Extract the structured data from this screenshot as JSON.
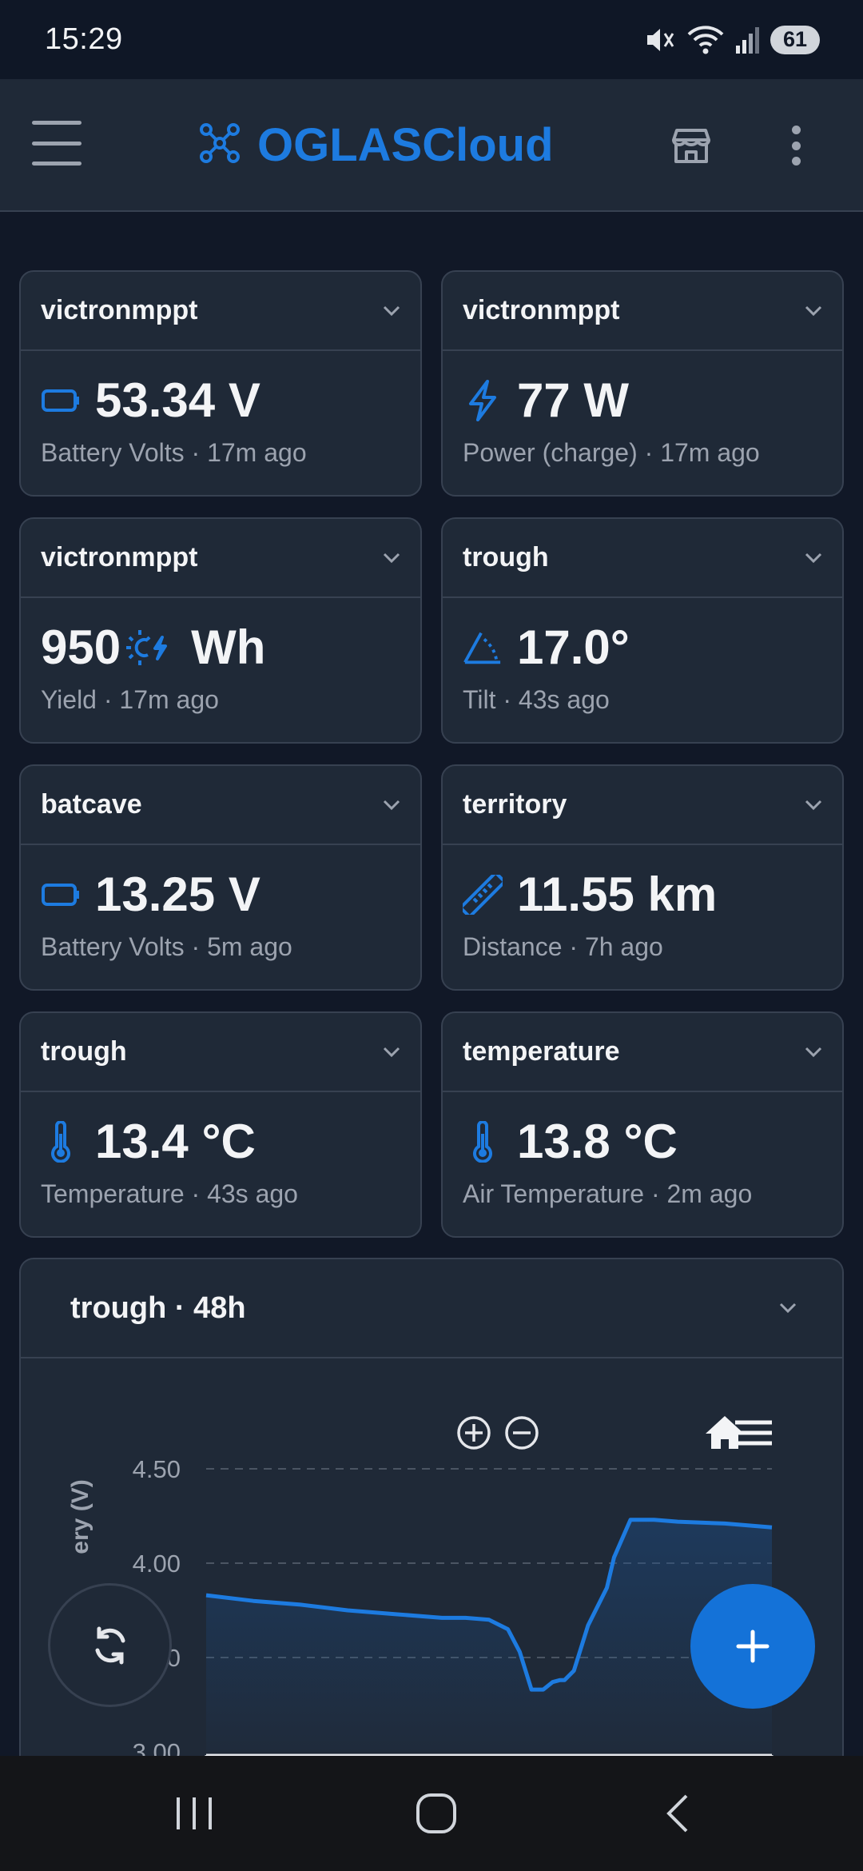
{
  "status_bar": {
    "time": "15:29",
    "battery": "61",
    "icons": [
      "mute-icon",
      "wifi-icon",
      "signal-icon",
      "battery-icon"
    ]
  },
  "header": {
    "title": "OGLASCloud",
    "icons": [
      "menu-icon",
      "brand-logo-icon",
      "store-icon",
      "more-vert-icon"
    ]
  },
  "cards": [
    {
      "device": "victronmppt",
      "value": "53.34 V",
      "sub": "Battery Volts · 17m ago",
      "icon": "battery-icon"
    },
    {
      "device": "victronmppt",
      "value": "77 W",
      "sub": "Power (charge) · 17m ago",
      "icon": "bolt-icon"
    },
    {
      "device": "victronmppt",
      "value": "950",
      "unit": "Wh",
      "sub": "Yield · 17m ago",
      "icon": "sun-bolt-icon"
    },
    {
      "device": "trough",
      "value": "17.0°",
      "sub": "Tilt · 43s ago",
      "icon": "angle-icon"
    },
    {
      "device": "batcave",
      "value": "13.25 V",
      "sub": "Battery Volts · 5m ago",
      "icon": "battery-icon"
    },
    {
      "device": "territory",
      "value": "11.55 km",
      "sub": "Distance · 7h ago",
      "icon": "ruler-icon"
    },
    {
      "device": "trough",
      "value": "13.4 °C",
      "sub": "Temperature · 43s ago",
      "icon": "thermometer-icon"
    },
    {
      "device": "temperature",
      "value": "13.8 °C",
      "sub": "Air Temperature · 2m ago",
      "icon": "thermometer-icon"
    }
  ],
  "chart_card": {
    "title": "trough · 48h"
  },
  "chart_data": {
    "type": "area",
    "ylabel_visible": "ery (V)",
    "y_ticks": [
      "4.50",
      "4.00",
      "0",
      "3.00"
    ],
    "ylim": [
      3.0,
      4.5
    ],
    "grid": true,
    "series": [
      {
        "x": [
          0,
          2,
          4,
          6,
          8,
          10,
          11,
          12,
          12.8,
          13.3,
          13.8,
          14.3,
          14.7,
          15,
          15.2,
          15.6,
          16.2,
          17,
          17.3,
          18,
          19,
          20,
          22,
          24
        ],
        "values": [
          3.83,
          3.8,
          3.78,
          3.75,
          3.73,
          3.71,
          3.71,
          3.7,
          3.65,
          3.53,
          3.33,
          3.33,
          3.37,
          3.38,
          3.38,
          3.43,
          3.67,
          3.87,
          4.03,
          4.23,
          4.23,
          4.22,
          4.21,
          4.19
        ]
      }
    ]
  },
  "nav_bar": {
    "icons": [
      "recents-icon",
      "home-icon",
      "back-icon"
    ]
  }
}
